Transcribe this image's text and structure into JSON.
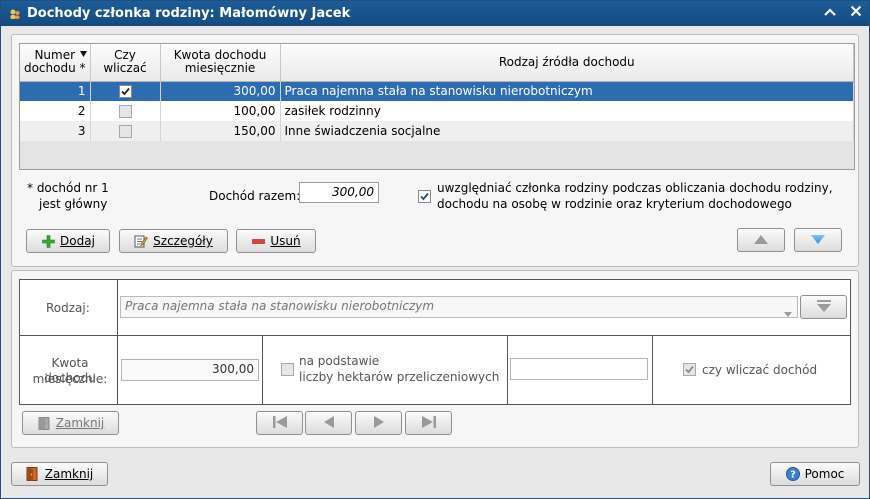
{
  "window": {
    "title": "Dochody członka rodziny: Małomówny Jacek",
    "minimize_glyph": "^",
    "close_glyph": "✕"
  },
  "grid": {
    "columns": [
      {
        "line1": "Numer",
        "line2": "dochodu *"
      },
      {
        "line1": "Czy",
        "line2": "wliczać"
      },
      {
        "line1": "Kwota dochodu",
        "line2": "miesięcznie"
      },
      {
        "line1": "Rodzaj źródła dochodu",
        "line2": ""
      }
    ],
    "rows": [
      {
        "num": "1",
        "checked": true,
        "amount": "300,00",
        "source": "Praca najemna stała na stanowisku nierobotniczym"
      },
      {
        "num": "2",
        "checked": false,
        "amount": "100,00",
        "source": "zasiłek rodzinny"
      },
      {
        "num": "3",
        "checked": false,
        "amount": "150,00",
        "source": "Inne świadczenia socjalne"
      }
    ]
  },
  "summary": {
    "note_line1": "* dochód nr 1",
    "note_line2": "jest główny",
    "total_label": "Dochód razem:",
    "total_value": "300,00",
    "include_line1": "uwzględniać członka rodziny podczas obliczania dochodu rodziny,",
    "include_line2": "dochodu na osobę w rodzinie oraz kryterium dochodowego",
    "include_checked": true
  },
  "actions": {
    "add": "Dodaj",
    "details": "Szczegóły",
    "remove": "Usuń"
  },
  "detail": {
    "type_label": "Rodzaj:",
    "type_value": "Praca najemna stała na stanowisku nierobotniczym",
    "amount_label_line1": "Kwota dochodu",
    "amount_label_line2": "miesięcznie:",
    "amount_value": "300,00",
    "hectares_line1": "na podstawie",
    "hectares_line2": "liczby hektarów przeliczeniowych",
    "hectares_value": "",
    "include_income_label": "czy wliczać dochód",
    "close_label": "Zamknij"
  },
  "footer": {
    "close_label": "Zamknij",
    "help_label": "Pomoc"
  }
}
